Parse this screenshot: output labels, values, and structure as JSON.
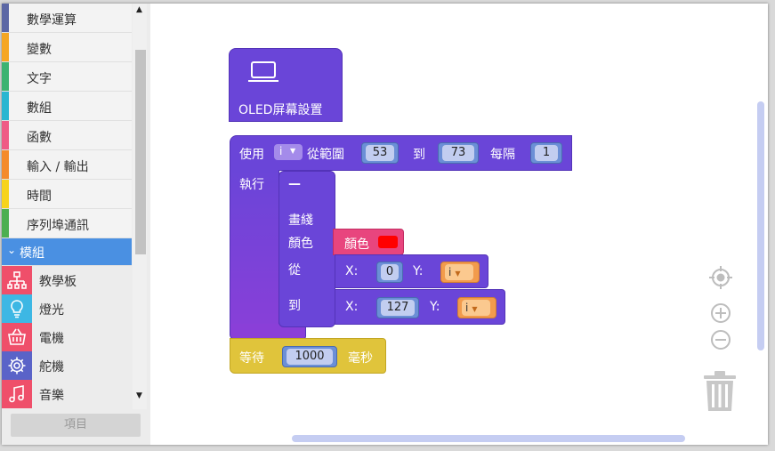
{
  "sidebar": {
    "categories": [
      {
        "label": "數學運算",
        "color": "#5b67a5"
      },
      {
        "label": "變數",
        "color": "#f5a623"
      },
      {
        "label": "文字",
        "color": "#3cb371"
      },
      {
        "label": "數組",
        "color": "#29b6d1"
      },
      {
        "label": "函數",
        "color": "#ef5b85"
      },
      {
        "label": "輸入 / 輸出",
        "color": "#f48b2b"
      },
      {
        "label": "時間",
        "color": "#f7d31b"
      },
      {
        "label": "序列埠通訊",
        "color": "#4caf50"
      }
    ],
    "selected": {
      "label": "模組",
      "chevron": "chevron-down-icon"
    },
    "subcategories": [
      {
        "label": "教學板",
        "icon": "circuit-board-icon",
        "color": "#ef4f6a"
      },
      {
        "label": "燈光",
        "icon": "lightbulb-icon",
        "color": "#3db7e4"
      },
      {
        "label": "電機",
        "icon": "basket-icon",
        "color": "#ef4f6a"
      },
      {
        "label": "舵機",
        "icon": "gear-icon",
        "color": "#5a63c8"
      },
      {
        "label": "音樂",
        "icon": "music-note-icon",
        "color": "#ef4f6a"
      }
    ],
    "items_button": "項目"
  },
  "blocks": {
    "oled": {
      "title": "OLED屏幕設置",
      "icon": "laptop-icon",
      "color": "#6a45d8"
    },
    "loop": {
      "use": "使用",
      "var": "i",
      "from": "從範圍",
      "start": "53",
      "to": "到",
      "end": "73",
      "step_label": "每隔",
      "step": "1",
      "do": "執行"
    },
    "line": {
      "dash": "—",
      "label": "畫綫",
      "color_label": "顏色",
      "from_label": "從",
      "to_label": "到",
      "color_block": "顏色",
      "color_value": "#ff0000",
      "from_x_label": "X:",
      "from_x": "0",
      "from_y_label": "Y:",
      "from_y": "i",
      "to_x_label": "X:",
      "to_x": "127",
      "to_y_label": "Y:",
      "to_y": "i"
    },
    "wait": {
      "label": "等待",
      "value": "1000",
      "unit": "毫秒",
      "color": "#e0c43b"
    }
  },
  "workspace_controls": [
    "crosshair-icon",
    "zoom-in-icon",
    "zoom-out-icon",
    "trash-icon"
  ]
}
